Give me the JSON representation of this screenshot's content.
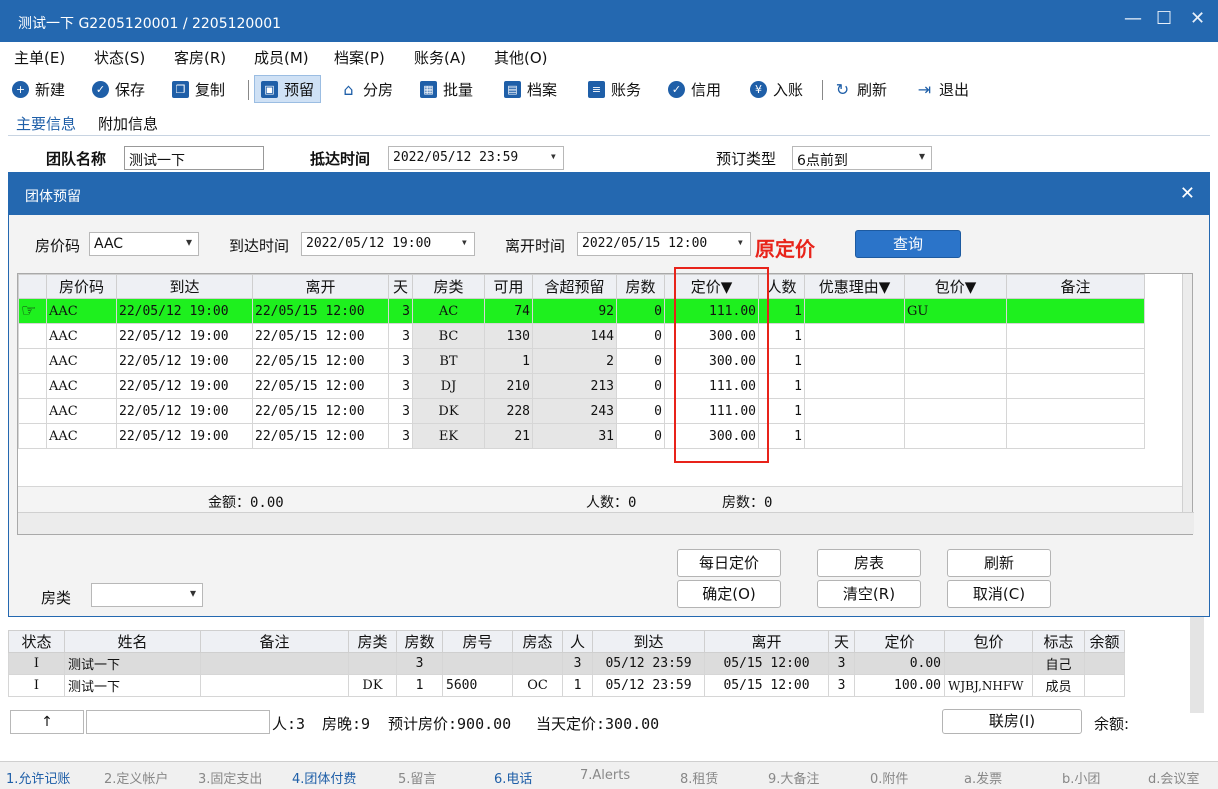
{
  "window": {
    "title": "测试一下 G2205120001 / 2205120001"
  },
  "menu": [
    "主单(E)",
    "状态(S)",
    "客房(R)",
    "成员(M)",
    "档案(P)",
    "账务(A)",
    "其他(O)"
  ],
  "toolbar": {
    "new": "新建",
    "save": "保存",
    "copy": "复制",
    "reserve": "预留",
    "assign": "分房",
    "batch": "批量",
    "profile": "档案",
    "account": "账务",
    "credit": "信用",
    "post": "入账",
    "refresh": "刷新",
    "exit": "退出"
  },
  "tabs": {
    "main": "主要信息",
    "extra": "附加信息"
  },
  "group": {
    "name_label": "团队名称",
    "name_value": "测试一下",
    "arrival_label": "抵达时间",
    "arrival_value": "2022/05/12 23:59",
    "type_label": "预订类型",
    "type_value": "6点前到"
  },
  "dialog": {
    "title": "团体预留",
    "rate_code_label": "房价码",
    "rate_code_value": "AAC",
    "arrive_label": "到达时间",
    "arrive_value": "2022/05/12 19:00",
    "depart_label": "离开时间",
    "depart_value": "2022/05/15 12:00",
    "query": "查询",
    "annotation": "原定价",
    "headers": [
      "房价码",
      "到达",
      "离开",
      "天",
      "房类",
      "可用",
      "含超预留",
      "房数",
      "定价▼",
      "人数",
      "优惠理由▼",
      "包价▼",
      "备注"
    ],
    "rows": [
      {
        "code": "AAC",
        "arrive": "22/05/12 19:00",
        "depart": "22/05/15 12:00",
        "days": "3",
        "type": "AC",
        "avail": "74",
        "over": "92",
        "rooms": "0",
        "price": "111.00",
        "people": "1",
        "reason": "",
        "pkg": "GU",
        "note": ""
      },
      {
        "code": "AAC",
        "arrive": "22/05/12 19:00",
        "depart": "22/05/15 12:00",
        "days": "3",
        "type": "BC",
        "avail": "130",
        "over": "144",
        "rooms": "0",
        "price": "300.00",
        "people": "1",
        "reason": "",
        "pkg": "",
        "note": ""
      },
      {
        "code": "AAC",
        "arrive": "22/05/12 19:00",
        "depart": "22/05/15 12:00",
        "days": "3",
        "type": "BT",
        "avail": "1",
        "over": "2",
        "rooms": "0",
        "price": "300.00",
        "people": "1",
        "reason": "",
        "pkg": "",
        "note": ""
      },
      {
        "code": "AAC",
        "arrive": "22/05/12 19:00",
        "depart": "22/05/15 12:00",
        "days": "3",
        "type": "DJ",
        "avail": "210",
        "over": "213",
        "rooms": "0",
        "price": "111.00",
        "people": "1",
        "reason": "",
        "pkg": "",
        "note": ""
      },
      {
        "code": "AAC",
        "arrive": "22/05/12 19:00",
        "depart": "22/05/15 12:00",
        "days": "3",
        "type": "DK",
        "avail": "228",
        "over": "243",
        "rooms": "0",
        "price": "111.00",
        "people": "1",
        "reason": "",
        "pkg": "",
        "note": ""
      },
      {
        "code": "AAC",
        "arrive": "22/05/12 19:00",
        "depart": "22/05/15 12:00",
        "days": "3",
        "type": "EK",
        "avail": "21",
        "over": "31",
        "rooms": "0",
        "price": "300.00",
        "people": "1",
        "reason": "",
        "pkg": "",
        "note": ""
      }
    ],
    "summary": {
      "amount": "金额：0.00",
      "people": "人数：0",
      "rooms": "房数：0"
    },
    "buttons": {
      "daily": "每日定价",
      "roomlist": "房表",
      "refresh": "刷新",
      "ok": "确定(O)",
      "clear": "清空(R)",
      "cancel": "取消(C)"
    },
    "room_type_label": "房类"
  },
  "members": {
    "headers": [
      "状态",
      "姓名",
      "备注",
      "房类",
      "房数",
      "房号",
      "房态",
      "人",
      "到达",
      "离开",
      "天",
      "定价",
      "包价",
      "标志",
      "余额"
    ],
    "rows": [
      {
        "status": "I",
        "name": "测试一下",
        "note": "",
        "type": "",
        "rooms": "3",
        "roomno": "",
        "rstate": "",
        "people": "3",
        "arrive": "05/12 23:59",
        "depart": "05/15 12:00",
        "days": "3",
        "price": "0.00",
        "pkg": "",
        "flag": "自己",
        "bal": ""
      },
      {
        "status": "I",
        "name": "测试一下",
        "note": "",
        "type": "DK",
        "rooms": "1",
        "roomno": "5600",
        "rstate": "OC",
        "people": "1",
        "arrive": "05/12 23:59",
        "depart": "05/15 12:00",
        "days": "3",
        "price": "100.00",
        "pkg": "WJBJ,NHFW",
        "flag": "成员",
        "bal": ""
      }
    ],
    "footer": {
      "people": "人:3",
      "nights": "房晚:9",
      "est": "预计房价:900.00",
      "today": "当天定价:300.00",
      "link": "联房(I)",
      "bal": "余额:"
    }
  },
  "status_bar": [
    "1.允许记账",
    "2.定义帐户",
    "3.固定支出",
    "4.团体付费",
    "5.留言",
    "6.电话",
    "7.Alerts",
    "8.租赁",
    "9.大备注",
    "0.附件",
    "a.发票",
    "b.小团",
    "d.会议室"
  ]
}
